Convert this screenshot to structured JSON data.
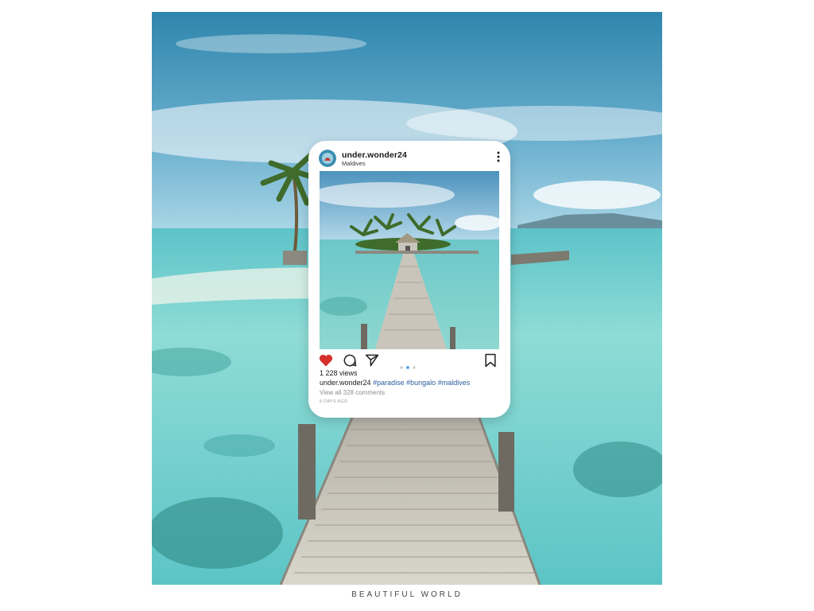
{
  "post": {
    "username": "under.wonder24",
    "location": "Maldives",
    "views": "1 228 views",
    "caption_user": "under.wonder24",
    "hashtags": [
      "#paradise",
      "#bungalo",
      "#maldives"
    ],
    "comments": "View all 328 comments",
    "time": "5 DAYS AGO",
    "liked": true,
    "carousel_dots": 3,
    "carousel_active": 2
  },
  "icons": {
    "more": "more-vertical-icon",
    "like": "heart-icon",
    "comment": "comment-icon",
    "share": "send-icon",
    "save": "bookmark-icon"
  },
  "colors": {
    "like": "#d6302c",
    "hashtag": "#2b5d9b",
    "water": "#7fd6d2",
    "sky": "#3f93b8"
  },
  "footer": {
    "title": "BEAUTIFUL WORLD"
  }
}
